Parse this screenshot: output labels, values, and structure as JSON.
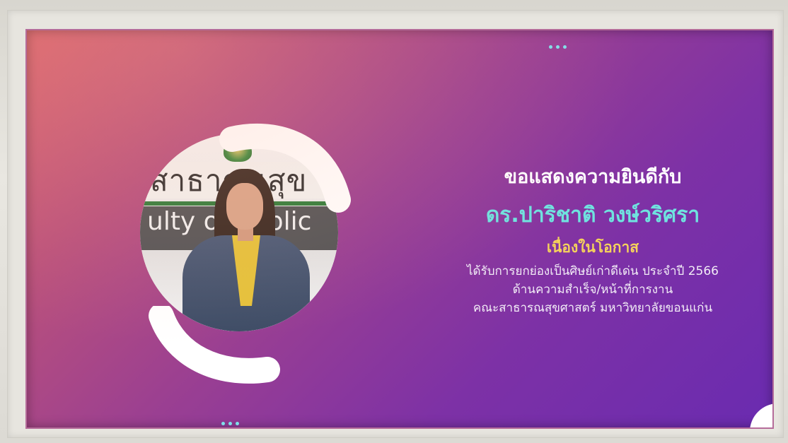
{
  "card": {
    "heading": "ขอแสดงความยินดีกับ",
    "name": "ดร.ปาริชาติ วงษ์วริศรา",
    "occasion": "เนื่องในโอกาส",
    "details": [
      "ได้รับการยกย่องเป็นศิษย์เก่าดีเด่น ประจำปี 2566",
      "ด้านความสำเร็จ/หน้าที่การงาน",
      "คณะสาธารณสุขศาสตร์ มหาวิทยาลัยขอนแก่น"
    ]
  },
  "photo": {
    "sign_thai": "สาธารณสุข",
    "sign_english": "ulty of Public"
  },
  "colors": {
    "gradient_start": "#d9646e",
    "gradient_end": "#6a2bb0",
    "name_color": "#6fe3df",
    "occasion_color": "#f5d25b",
    "dots_color": "#7fe0ea"
  }
}
